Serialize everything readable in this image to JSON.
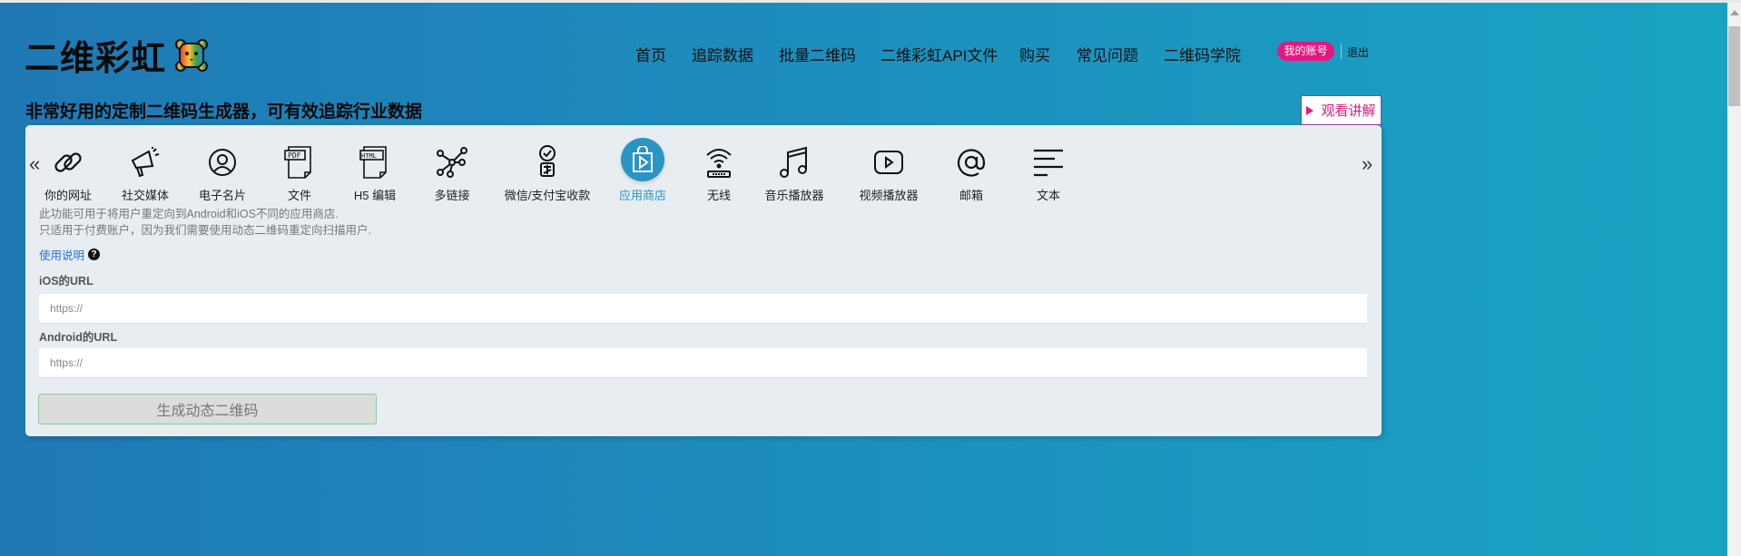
{
  "header": {
    "logo_text": "二维彩虹",
    "subtitle": "非常好用的定制二维码生成器，可有效追踪行业数据",
    "nav": [
      "首页",
      "追踪数据",
      "批量二维码",
      "二维彩虹API文件",
      "购买",
      "常见问题",
      "二维码学院"
    ],
    "account_label": "我的账号",
    "logout_label": "退出",
    "watch_label": "观看讲解"
  },
  "tabs": [
    {
      "label": "你的网址",
      "icon": "link-icon"
    },
    {
      "label": "社交媒体",
      "icon": "megaphone-icon"
    },
    {
      "label": "电子名片",
      "icon": "user-circle-icon"
    },
    {
      "label": "文件",
      "icon": "pdf-file-icon"
    },
    {
      "label": "H5 编辑",
      "icon": "html-file-icon"
    },
    {
      "label": "多链接",
      "icon": "multi-link-icon"
    },
    {
      "label": "微信/支付宝收款",
      "icon": "payment-icon"
    },
    {
      "label": "应用商店",
      "icon": "app-store-icon",
      "active": true
    },
    {
      "label": "无线",
      "icon": "wifi-icon"
    },
    {
      "label": "音乐播放器",
      "icon": "music-icon"
    },
    {
      "label": "视频播放器",
      "icon": "video-icon"
    },
    {
      "label": "邮箱",
      "icon": "at-icon"
    },
    {
      "label": "文本",
      "icon": "text-icon"
    }
  ],
  "nav_prev": "«",
  "nav_next": "»",
  "description": [
    "此功能可用于将用户重定向到Android和iOS不同的应用商店.",
    "只适用于付费账户，因为我们需要使用动态二维码重定向扫描用户."
  ],
  "help_label": "使用说明",
  "help_icon": "?",
  "form": {
    "ios_label": "iOS的URL",
    "ios_placeholder": "https://",
    "android_label": "Android的URL",
    "android_placeholder": "https://",
    "submit_label": "生成动态二维码"
  },
  "colors": {
    "accent": "#2a95c4",
    "pink": "#e6177f"
  }
}
